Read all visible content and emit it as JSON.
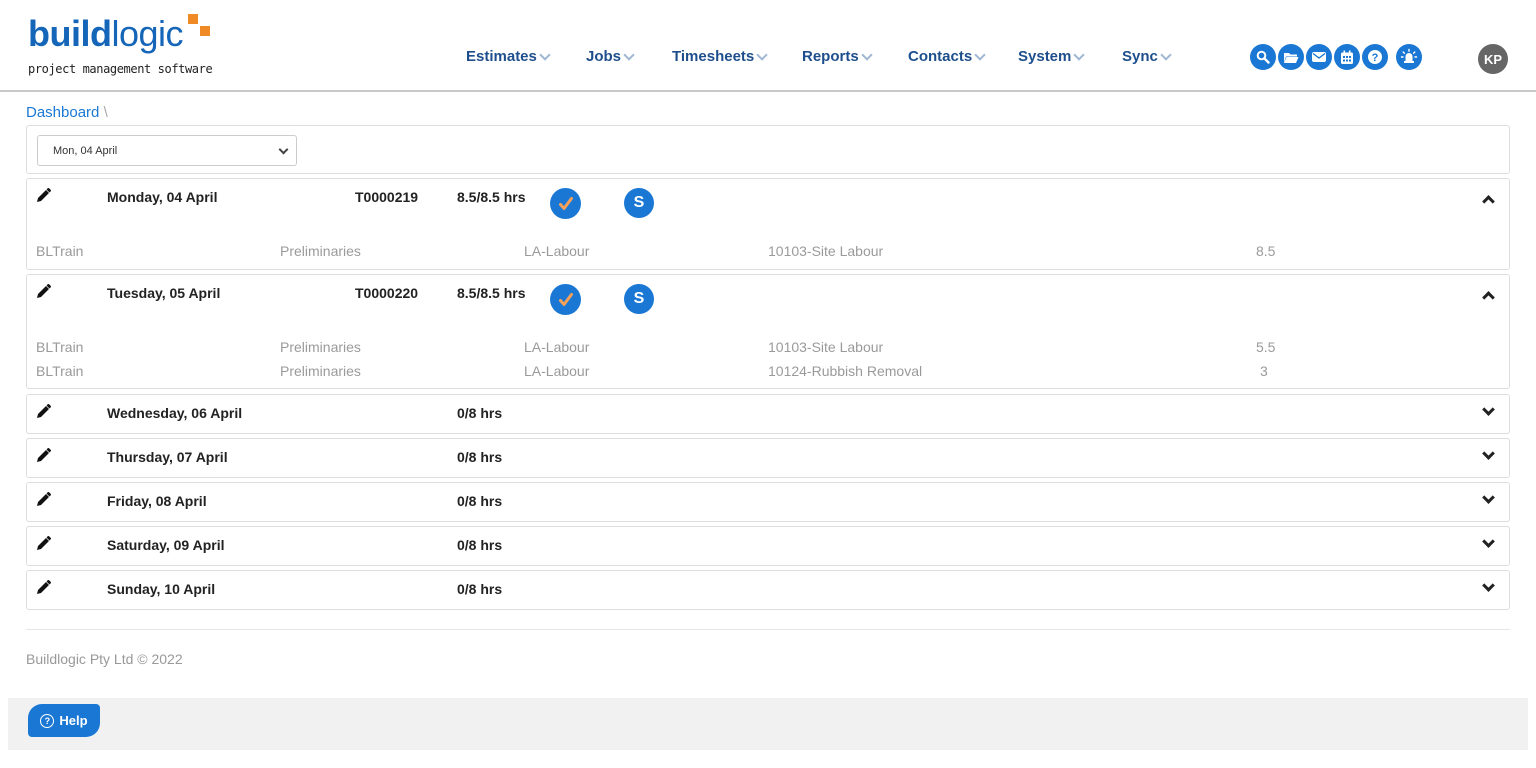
{
  "brand": {
    "logo_bold": "build",
    "logo_light": "logic",
    "tagline": "project management software",
    "accent_color": "#f08a24",
    "brand_color": "#1565b8"
  },
  "nav": {
    "items": [
      {
        "label": "Estimates"
      },
      {
        "label": "Jobs"
      },
      {
        "label": "Timesheets"
      },
      {
        "label": "Reports"
      },
      {
        "label": "Contacts"
      },
      {
        "label": "System"
      },
      {
        "label": "Sync"
      }
    ],
    "icons": [
      "search-icon",
      "folder-icon",
      "mail-icon",
      "calendar-icon",
      "help-icon",
      "alert-icon"
    ],
    "user_initials": "KP"
  },
  "breadcrumb": {
    "link": "Dashboard",
    "separator": "\\"
  },
  "date_select": {
    "value": "Mon, 04 April"
  },
  "days": [
    {
      "label": "Monday, 04 April",
      "code": "T0000219",
      "hours": "8.5/8.5 hrs",
      "approved": true,
      "synced_label": "S",
      "expanded": true,
      "lines": [
        {
          "project": "BLTrain",
          "stage": "Preliminaries",
          "resource": "LA-Labour",
          "cost_code": "10103-Site Labour",
          "qty": "8.5"
        }
      ]
    },
    {
      "label": "Tuesday, 05 April",
      "code": "T0000220",
      "hours": "8.5/8.5 hrs",
      "approved": true,
      "synced_label": "S",
      "expanded": true,
      "lines": [
        {
          "project": "BLTrain",
          "stage": "Preliminaries",
          "resource": "LA-Labour",
          "cost_code": "10103-Site Labour",
          "qty": "5.5"
        },
        {
          "project": "BLTrain",
          "stage": "Preliminaries",
          "resource": "LA-Labour",
          "cost_code": "10124-Rubbish Removal",
          "qty": "3"
        }
      ]
    },
    {
      "label": "Wednesday, 06 April",
      "hours": "0/8 hrs",
      "expanded": false
    },
    {
      "label": "Thursday, 07 April",
      "hours": "0/8 hrs",
      "expanded": false
    },
    {
      "label": "Friday, 08 April",
      "hours": "0/8 hrs",
      "expanded": false
    },
    {
      "label": "Saturday, 09 April",
      "hours": "0/8 hrs",
      "expanded": false
    },
    {
      "label": "Sunday, 10 April",
      "hours": "0/8 hrs",
      "expanded": false
    }
  ],
  "footer": {
    "copyright": "Buildlogic Pty Ltd © 2022",
    "help_label": "Help",
    "help_icon_glyph": "?"
  }
}
